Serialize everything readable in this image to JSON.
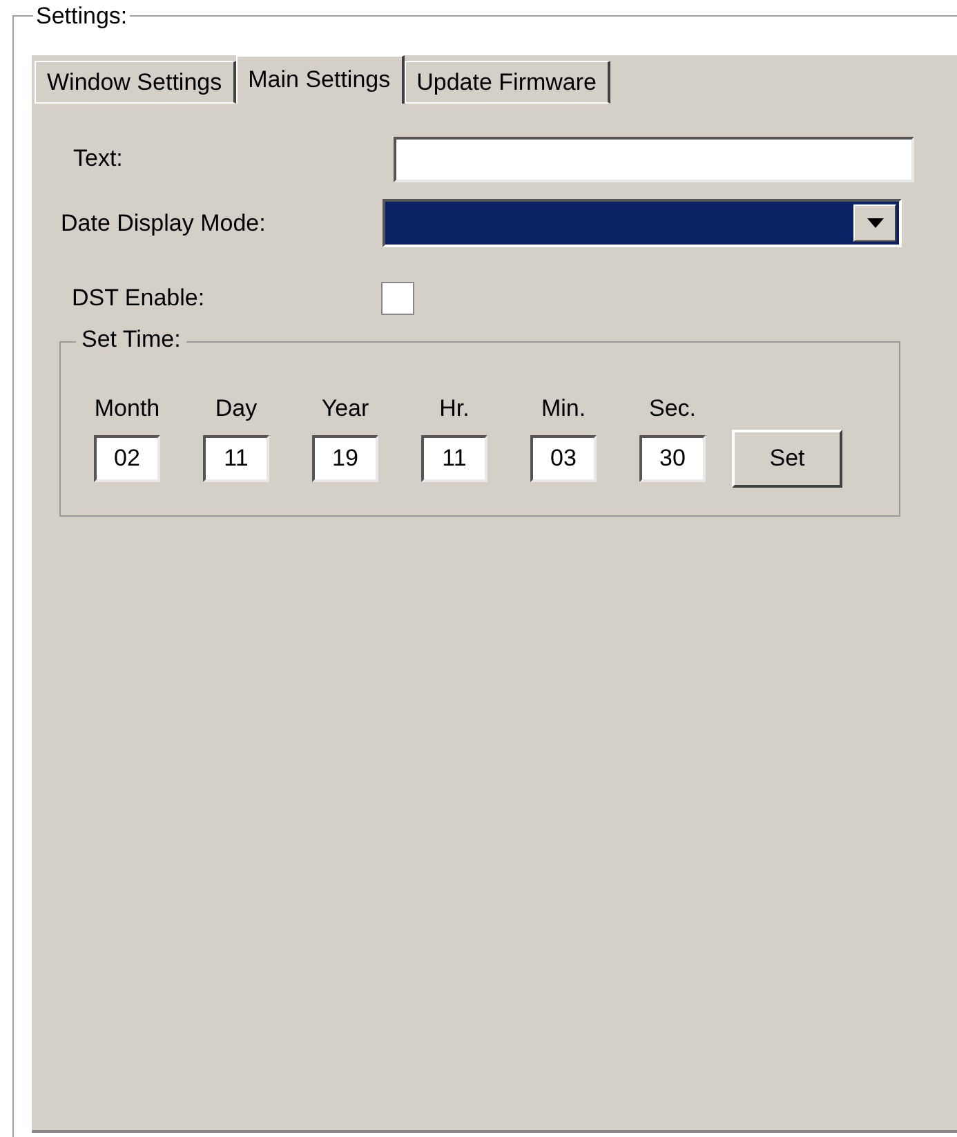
{
  "group_title": "Settings:",
  "tabs": [
    {
      "label": "Window Settings",
      "selected": false
    },
    {
      "label": "Main Settings",
      "selected": true
    },
    {
      "label": "Update Firmware",
      "selected": false
    }
  ],
  "text_field": {
    "label": "Text:"
  },
  "date_display_mode": {
    "label": "Date Display Mode:"
  },
  "dst_enable": {
    "label": "DST Enable:",
    "checked": false
  },
  "set_time": {
    "title": "Set Time:",
    "fields": [
      {
        "label": "Month",
        "value": "02"
      },
      {
        "label": "Day",
        "value": "11"
      },
      {
        "label": "Year",
        "value": "19"
      },
      {
        "label": "Hr.",
        "value": "11"
      },
      {
        "label": "Min.",
        "value": "03"
      },
      {
        "label": "Sec.",
        "value": "30"
      }
    ],
    "button": "Set"
  }
}
